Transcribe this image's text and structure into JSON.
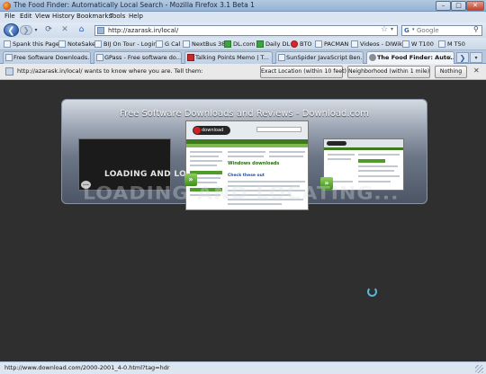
{
  "window": {
    "title": "The Food Finder: Automatically Local Search - Mozilla Firefox 3.1 Beta 1",
    "controls": {
      "minimize": "–",
      "maximize": "□",
      "close": "✕"
    }
  },
  "menu": [
    "File",
    "Edit",
    "View",
    "History",
    "Bookmarks",
    "Tools",
    "Help"
  ],
  "nav": {
    "back_glyph": "❮",
    "forward_glyph": "❯",
    "dropdown_glyph": "▾",
    "reload_glyph": "⟳",
    "stop_glyph": "✕",
    "home_glyph": "⌂",
    "url": "http://azarask.in/local/",
    "star_glyph": "☆",
    "search_placeholder": "Google",
    "search_engine_glyph": "G"
  },
  "bookmarks": [
    {
      "label": "Spank this Page!"
    },
    {
      "label": "NoteSake"
    },
    {
      "label": "BIJ On Tour - Login"
    },
    {
      "label": "G Cal"
    },
    {
      "label": "NextBus 38"
    },
    {
      "label": "DL.com"
    },
    {
      "label": "Daily DL"
    },
    {
      "label": "BTO"
    },
    {
      "label": "PACMAN"
    },
    {
      "label": "Videos - DIWiki"
    },
    {
      "label": "W T100"
    },
    {
      "label": "M T50"
    }
  ],
  "tabs": [
    {
      "label": "Free Software Downloads...",
      "active": false
    },
    {
      "label": "GPass - Free software do...",
      "active": false
    },
    {
      "label": "Talking Points Memo | T...",
      "active": false
    },
    {
      "label": "SunSpider JavaScript Ben...",
      "active": false
    },
    {
      "label": "The Food Finder: Auto...",
      "active": true
    }
  ],
  "notification": {
    "text": "http://azarask.in/local/ wants to know where you are. Tell them:",
    "buttons": [
      "Exact Location (within 10 feet)",
      "Neighborhood (within 1 mile)",
      "Nothing"
    ],
    "close_glyph": "✕"
  },
  "content": {
    "panel_title": "Free Software Downloads and Reviews - Download.com",
    "loading_text": "Loading and lo",
    "reflection_text": "LOADING AND LOCATING...",
    "thumb_center": {
      "logo": "download",
      "heading": "Windows downloads",
      "subheading": "Check these out"
    }
  },
  "status": {
    "text": "http://www.download.com/2000-2001_4-0.html?tag=hdr"
  },
  "colors": {
    "content_bg": "#2f2f2f",
    "chrome_blue": "#cfdceb",
    "download_green": "#3d7a1e"
  }
}
